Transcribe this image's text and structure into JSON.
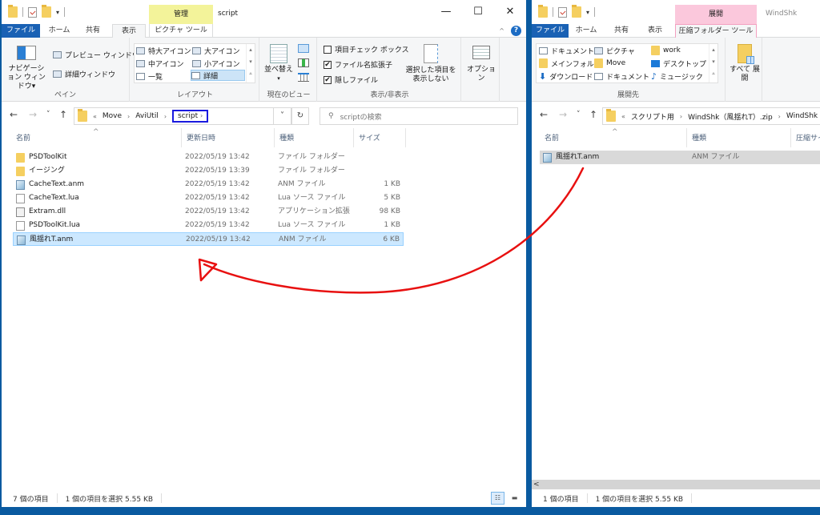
{
  "left_window": {
    "title": "script",
    "context_tab": "管理",
    "context_color": "#f3f39a",
    "window_controls": {
      "minimize": "—",
      "maximize": "☐",
      "close": "✕"
    },
    "tabs": [
      "ファイル",
      "ホーム",
      "共有",
      "表示",
      "ピクチャ ツール"
    ],
    "active_tab": "表示",
    "ribbon": {
      "pane_group": {
        "label": "ペイン",
        "nav_pane": "ナビゲーション ウィンドウ▾",
        "preview_pane": "プレビュー ウィンドウ",
        "details_pane": "詳細ウィンドウ"
      },
      "layout_group": {
        "label": "レイアウト",
        "items": [
          "特大アイコン",
          "大アイコン",
          "中アイコン",
          "小アイコン",
          "一覧",
          "詳細"
        ],
        "selected": "詳細"
      },
      "current_view_group": {
        "label": "現在のビュー",
        "sort_by": "並べ替え"
      },
      "show_hide_group": {
        "label": "表示/非表示",
        "checkboxes": [
          {
            "label": "項目チェック ボックス",
            "checked": false
          },
          {
            "label": "ファイル名拡張子",
            "checked": true
          },
          {
            "label": "隠しファイル",
            "checked": true
          }
        ],
        "hide_selected": "選択した項目を 表示しない"
      },
      "options": "オプション"
    },
    "nav": {
      "back": "←",
      "forward": "→",
      "recent": "˅",
      "up": "↑"
    },
    "breadcrumb": [
      "«",
      "Move",
      "AviUtil",
      "script"
    ],
    "breadcrumb_highlight_color": "#1a1adf",
    "address_dropdown": "˅",
    "refresh": "↻",
    "search_placeholder": "scriptの検索",
    "columns": [
      "名前",
      "更新日時",
      "種類",
      "サイズ"
    ],
    "files": [
      {
        "name": "PSDToolKit",
        "icon": "folder-icon",
        "date": "2022/05/19 13:42",
        "type": "ファイル フォルダー",
        "size": ""
      },
      {
        "name": "イージング",
        "icon": "folder-icon",
        "date": "2022/05/19 13:39",
        "type": "ファイル フォルダー",
        "size": ""
      },
      {
        "name": "CacheText.anm",
        "icon": "anm-file-icon",
        "date": "2022/05/19 13:42",
        "type": "ANM ファイル",
        "size": "1 KB"
      },
      {
        "name": "CacheText.lua",
        "icon": "lua-file-icon",
        "date": "2022/05/19 13:42",
        "type": "Lua ソース ファイル",
        "size": "5 KB"
      },
      {
        "name": "Extram.dll",
        "icon": "dll-file-icon",
        "date": "2022/05/19 13:42",
        "type": "アプリケーション拡張",
        "size": "98 KB"
      },
      {
        "name": "PSDToolKit.lua",
        "icon": "lua-file-icon",
        "date": "2022/05/19 13:42",
        "type": "Lua ソース ファイル",
        "size": "1 KB"
      },
      {
        "name": "風揺れT.anm",
        "icon": "anm-file-icon",
        "date": "2022/05/19 13:42",
        "type": "ANM ファイル",
        "size": "6 KB",
        "selected": true
      }
    ],
    "status": {
      "count": "7 個の項目",
      "selection": "1 個の項目を選択  5.55 KB"
    }
  },
  "right_window": {
    "title": "WindShk",
    "context_tab": "展開",
    "context_color": "#fbc8dc",
    "tabs": [
      "ファイル",
      "ホーム",
      "共有",
      "表示",
      "圧縮フォルダー ツール"
    ],
    "active_tab": "圧縮フォルダー ツール",
    "ribbon": {
      "extract_to_group": {
        "label": "展開先",
        "items": [
          "ドキュメント",
          "ピクチャ",
          "work",
          "メインフォルダ",
          "Move",
          "デスクトップ",
          "ダウンロード",
          "ドキュメント",
          "ミュージック"
        ]
      },
      "extract_all": "すべて 展開"
    },
    "nav": {
      "back": "←",
      "forward": "→",
      "recent": "˅",
      "up": "↑"
    },
    "breadcrumb": [
      "«",
      "スクリプト用",
      "WindShk（風揺れT）.zip",
      "WindShk"
    ],
    "columns": [
      "名前",
      "種類",
      "圧縮サイズ"
    ],
    "files": [
      {
        "name": "風揺れT.anm",
        "icon": "anm-file-icon",
        "type": "ANM ファイル",
        "selected": true
      }
    ],
    "scroll_left": "<",
    "status": {
      "count": "1 個の項目",
      "selection": "1 個の項目を選択  5.55 KB"
    }
  },
  "annotation": {
    "arrow_color": "#e81010",
    "description": "drag arrow from right window file to left window file list"
  }
}
